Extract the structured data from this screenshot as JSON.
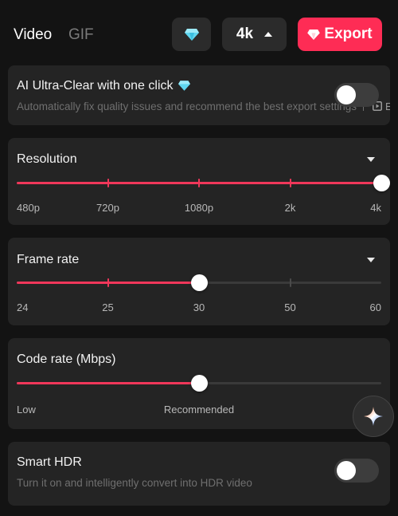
{
  "tabs": {
    "video": "Video",
    "gif": "GIF"
  },
  "toolbar": {
    "resolution_label": "4k",
    "export_label": "Export",
    "diamond_icon": "diamond-icon",
    "export_color": "#fe2c55"
  },
  "ai_clear": {
    "title": "AI Ultra-Clear with one click",
    "description": "Automatically fix quality issues and recommend the best export settings",
    "enabled": false
  },
  "resolution": {
    "title": "Resolution",
    "ticks": [
      "480p",
      "720p",
      "1080p",
      "2k",
      "4k"
    ],
    "selected": "4k"
  },
  "frame_rate": {
    "title": "Frame rate",
    "ticks": [
      "24",
      "25",
      "30",
      "50",
      "60"
    ],
    "selected": "30"
  },
  "code_rate": {
    "title": "Code rate (Mbps)",
    "low_label": "Low",
    "recommended_label": "Recommended",
    "level": 0.5
  },
  "smart_hdr": {
    "title": "Smart HDR",
    "description": "Turn it on and intelligently convert into HDR video",
    "enabled": false
  },
  "colors": {
    "accent": "#f0375a",
    "card": "#242424",
    "background": "#131313"
  }
}
